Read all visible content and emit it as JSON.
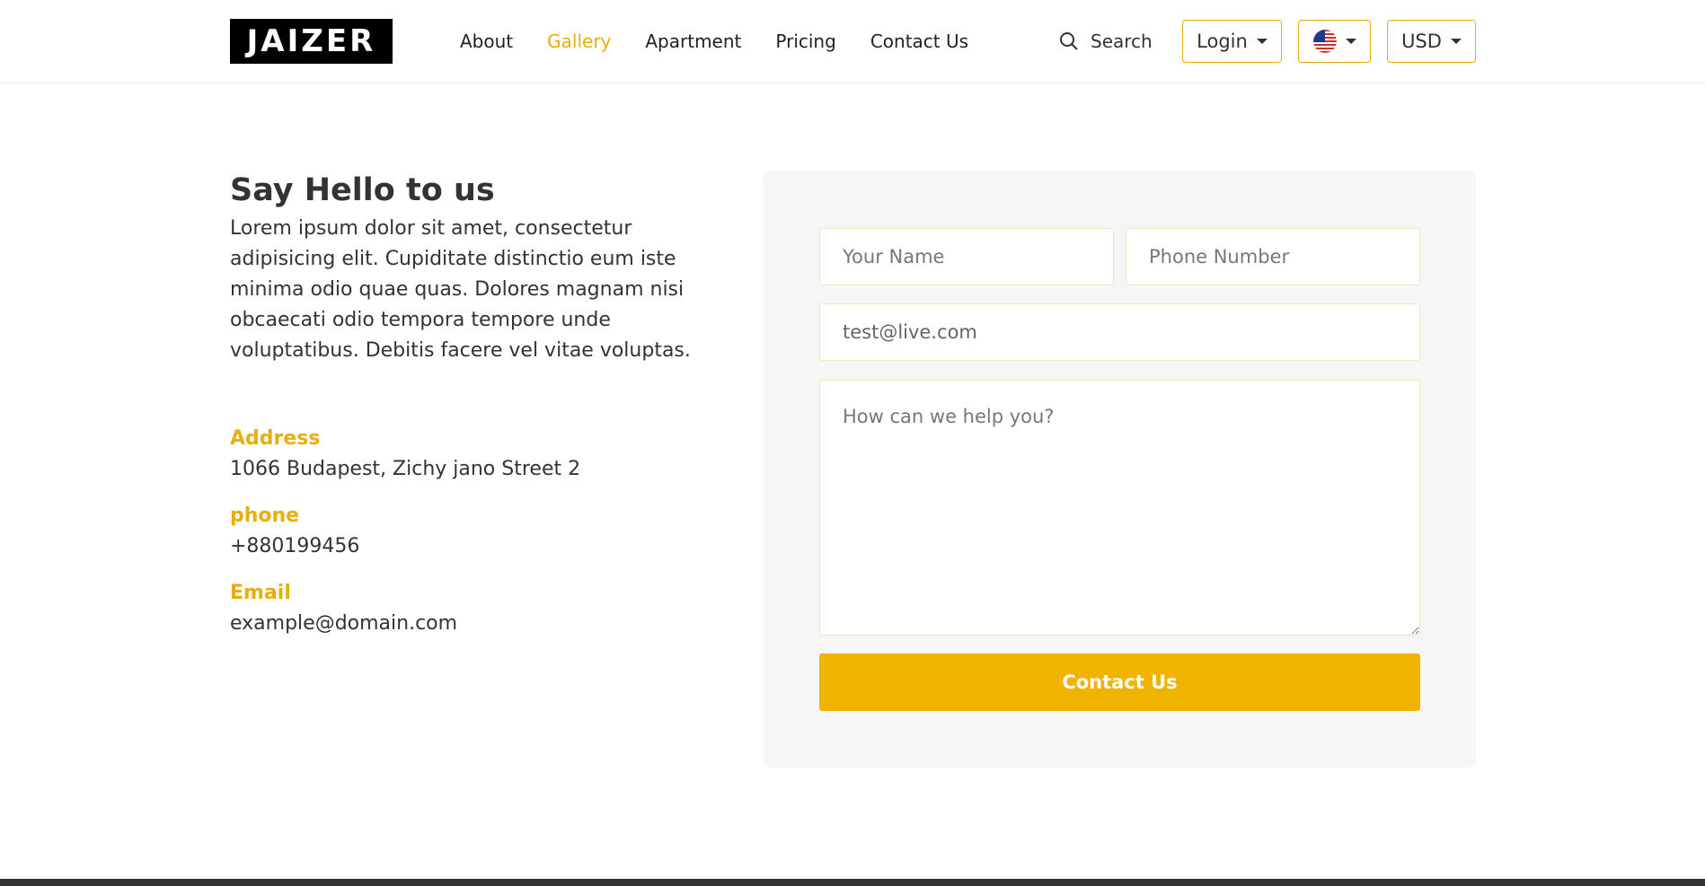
{
  "header": {
    "logo_text": "JAIZER",
    "nav": [
      {
        "label": "About",
        "active": false
      },
      {
        "label": "Gallery",
        "active": true
      },
      {
        "label": "Apartment",
        "active": false
      },
      {
        "label": "Pricing",
        "active": false
      },
      {
        "label": "Contact Us",
        "active": false
      }
    ],
    "search_label": "Search",
    "login_label": "Login",
    "language_icon": "us-flag-icon",
    "currency_label": "USD"
  },
  "contact": {
    "title": "Say Hello to us",
    "description": "Lorem ipsum dolor sit amet, consectetur adipisicing elit. Cupiditate distinctio eum iste minima odio quae quas. Dolores magnam nisi obcaecati odio tempora tempore unde voluptatibus. Debitis facere vel vitae voluptas.",
    "address_label": "Address",
    "address_value": "1066 Budapest, Zichy jano Street 2",
    "phone_label": "phone",
    "phone_value": "+880199456",
    "email_label": "Email",
    "email_value": "example@domain.com"
  },
  "form": {
    "name_placeholder": "Your Name",
    "phone_placeholder": "Phone Number",
    "email_value": "test@live.com",
    "message_placeholder": "How can we help you?",
    "submit_label": "Contact Us"
  },
  "colors": {
    "accent": "#efb300",
    "text": "#333333",
    "card_bg": "#f6f6f6"
  }
}
